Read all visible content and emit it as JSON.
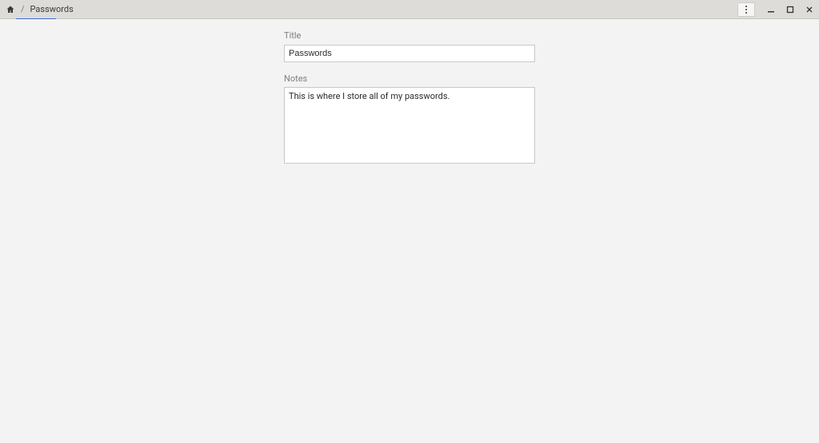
{
  "breadcrumb": {
    "separator": "/",
    "current": "Passwords"
  },
  "form": {
    "title_label": "Title",
    "title_value": "Passwords",
    "notes_label": "Notes",
    "notes_value": "This is where I store all of my passwords."
  }
}
